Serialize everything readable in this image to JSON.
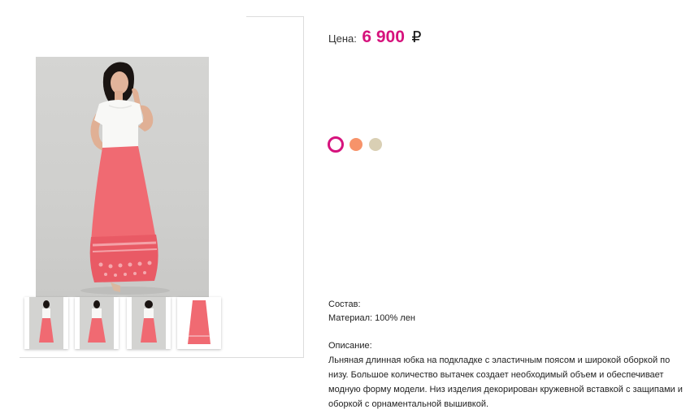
{
  "product": {
    "price_label": "Цена:",
    "price_value": "6 900",
    "currency": "₽",
    "colors": [
      {
        "name": "selected-swatch",
        "hex": "#d6137d"
      },
      {
        "name": "coral",
        "hex": "#f7936a"
      },
      {
        "name": "beige",
        "hex": "#d9cfb4"
      }
    ],
    "composition_label": "Состав:",
    "material": "Материал: 100% лен",
    "description_label": "Описание:",
    "description": "Льняная длинная юбка на подкладке с эластичным поясом и широкой оборкой по низу. Большое количество вытачек  создает необходимый объем и обеспечивает модную форму модели. Низ изделия декорирован кружевной вставкой с защипами и оборкой с орнаментальной вышивкой."
  },
  "colors": {
    "accent": "#d6137d",
    "skirt": "#f06a72",
    "skirt_dark": "#e0555f",
    "photo_bg": "#d3d3d1"
  }
}
